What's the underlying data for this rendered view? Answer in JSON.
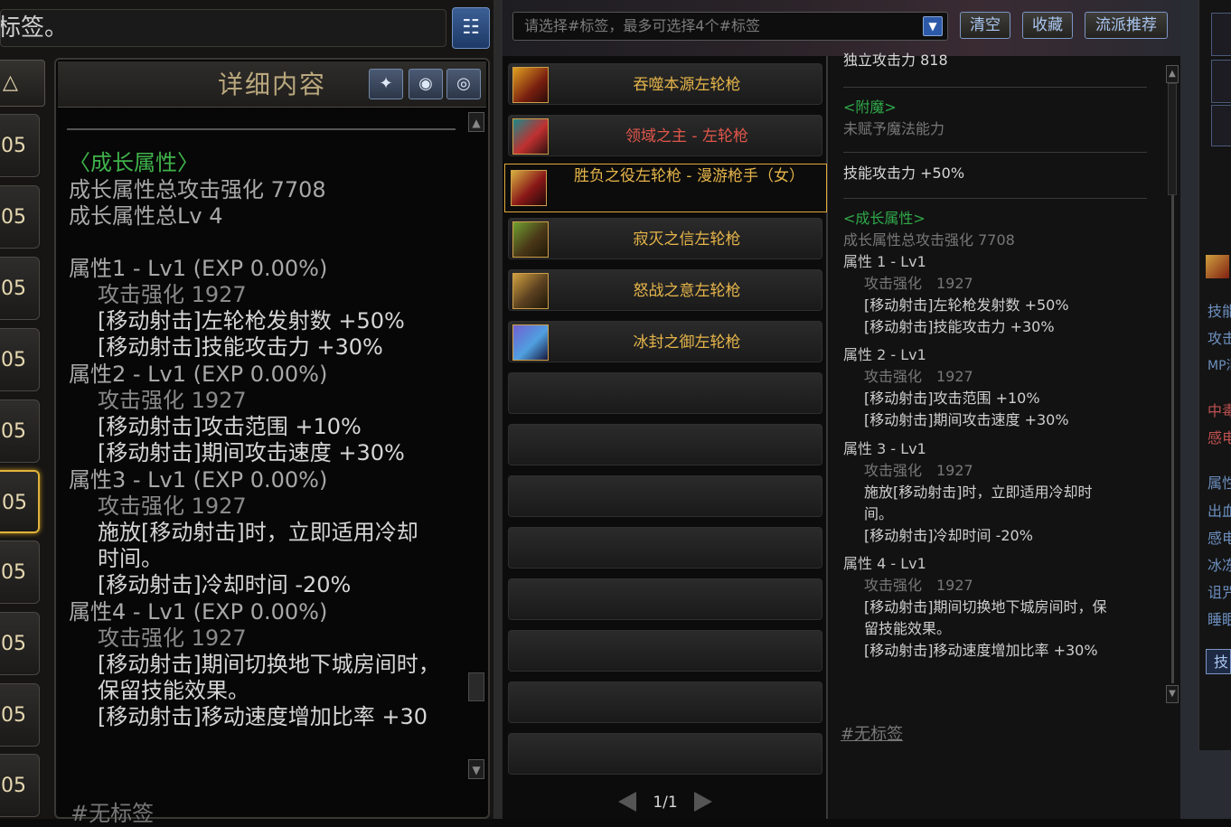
{
  "left_panel": {
    "tag_input_text": "标签。",
    "sort_tab": "△",
    "side_tab_value": "05",
    "detail_title": "详细内容",
    "header_buttons": [
      "filter-icon",
      "location-icon",
      "eye-icon"
    ],
    "growth_title": "〈成长属性〉",
    "growth_total_attack": "成长属性总攻击强化 7708",
    "growth_total_lv": "成长属性总Lv 4",
    "attr1_title": "属性1 - Lv1 (EXP 0.00%)",
    "attr1_l1": "攻击强化 1927",
    "attr1_l2": "[移动射击]左轮枪发射数 +50%",
    "attr1_l3": "[移动射击]技能攻击力 +30%",
    "attr2_title": "属性2 - Lv1 (EXP 0.00%)",
    "attr2_l1": "攻击强化 1927",
    "attr2_l2": "[移动射击]攻击范围 +10%",
    "attr2_l3": "[移动射击]期间攻击速度 +30%",
    "attr3_title": "属性3 - Lv1 (EXP 0.00%)",
    "attr3_l1": "攻击强化 1927",
    "attr3_l2": "施放[移动射击]时，立即适用冷却",
    "attr3_l3": "时间。",
    "attr3_l4": "[移动射击]冷却时间 -20%",
    "attr4_title": "属性4 - Lv1 (EXP 0.00%)",
    "attr4_l1": "攻击强化 1927",
    "attr4_l2": "[移动射击]期间切换地下城房间时，",
    "attr4_l3": "保留技能效果。",
    "attr4_l4": "[移动射击]移动速度增加比率 +30",
    "footer_tag": "#无标签"
  },
  "top_bar": {
    "tag_select_placeholder": "请选择#标签，最多可选择4个#标签",
    "clear_label": "清空",
    "favorite_label": "收藏",
    "recommend_label": "流派推荐"
  },
  "items": [
    {
      "label": "吞噬本源左轮枪",
      "color": "#e6b54a"
    },
    {
      "label": "领域之主 - 左轮枪",
      "color": "#e0564a"
    },
    {
      "label": "胜负之役左轮枪 - 漫游枪手（女）",
      "color": "#e6b54a"
    },
    {
      "label": "寂灭之信左轮枪",
      "color": "#e6b54a"
    },
    {
      "label": "怒战之意左轮枪",
      "color": "#e6b54a"
    },
    {
      "label": "冰封之御左轮枪",
      "color": "#e6b54a"
    }
  ],
  "pager": {
    "text": "1/1"
  },
  "detail": {
    "top_cut": "独立攻击力 818",
    "enchant_title": "<附魔>",
    "enchant_none": "未赋予魔法能力",
    "skill_attack": "技能攻击力 +50%",
    "growth_title": "<成长属性>",
    "growth_total": "成长属性总攻击强化 7708",
    "a1_title": "属性 1 - Lv1",
    "a1_l1": "攻击强化　1927",
    "a1_l2": "[移动射击]左轮枪发射数 +50%",
    "a1_l3": "[移动射击]技能攻击力 +30%",
    "a2_title": "属性 2 - Lv1",
    "a2_l1": "攻击强化　1927",
    "a2_l2": "[移动射击]攻击范围 +10%",
    "a2_l3": "[移动射击]期间攻击速度 +30%",
    "a3_title": "属性 3 - Lv1",
    "a3_l1": "攻击强化　1927",
    "a3_l2": "施放[移动射击]时，立即适用冷却时",
    "a3_l3": "间。",
    "a3_l4": "[移动射击]冷却时间 -20%",
    "a4_title": "属性 4 - Lv1",
    "a4_l1": "攻击强化　1927",
    "a4_l2": "[移动射击]期间切换地下城房间时，保",
    "a4_l3": "留技能效果。",
    "a4_l4": "[移动射击]移动速度增加比率 +30%",
    "tag": "#无标签"
  },
  "far_right": {
    "lines": [
      "技能",
      "攻击",
      "MP消",
      "中毒",
      "感电",
      "属性",
      "出血",
      "感电",
      "冰冻",
      "诅咒",
      "睡眠",
      "技"
    ]
  }
}
